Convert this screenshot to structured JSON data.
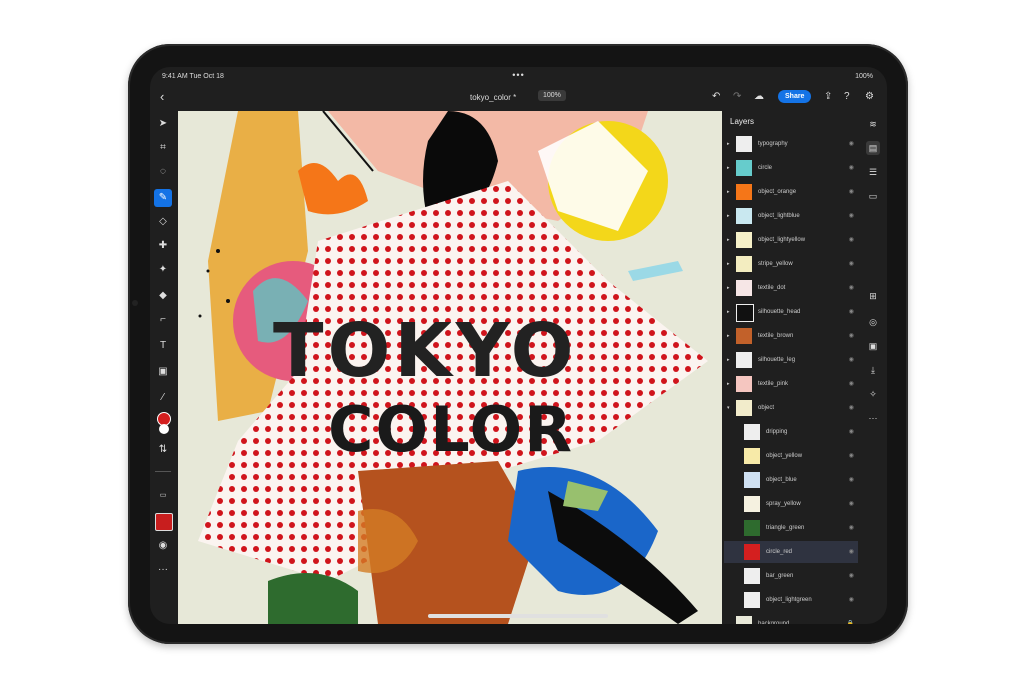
{
  "status": {
    "time": "9:41 AM  Tue Oct 18",
    "battery": "100%"
  },
  "topbar": {
    "doc_title": "tokyo_color *",
    "zoom": "100%",
    "share_label": "Share"
  },
  "layers_panel": {
    "title": "Layers",
    "items": [
      {
        "name": "typography"
      },
      {
        "name": "circle"
      },
      {
        "name": "object_orange"
      },
      {
        "name": "object_lightblue"
      },
      {
        "name": "object_lightyellow"
      },
      {
        "name": "stripe_yellow"
      },
      {
        "name": "textile_dot"
      },
      {
        "name": "silhouette_head"
      },
      {
        "name": "textile_brown"
      },
      {
        "name": "silhouette_leg"
      },
      {
        "name": "textile_pink"
      },
      {
        "name": "object"
      },
      {
        "name": "dripping"
      },
      {
        "name": "object_yellow"
      },
      {
        "name": "object_blue"
      },
      {
        "name": "spray_yellow"
      },
      {
        "name": "triangle_green"
      },
      {
        "name": "circle_red"
      },
      {
        "name": "bar_green"
      },
      {
        "name": "object_lightgreen"
      },
      {
        "name": "background"
      }
    ]
  },
  "canvas": {
    "text_line1": "TOKYO",
    "text_line2": "COLOR"
  },
  "colors": {
    "accent": "#1473e6",
    "selected_layer": "#2f3340"
  }
}
